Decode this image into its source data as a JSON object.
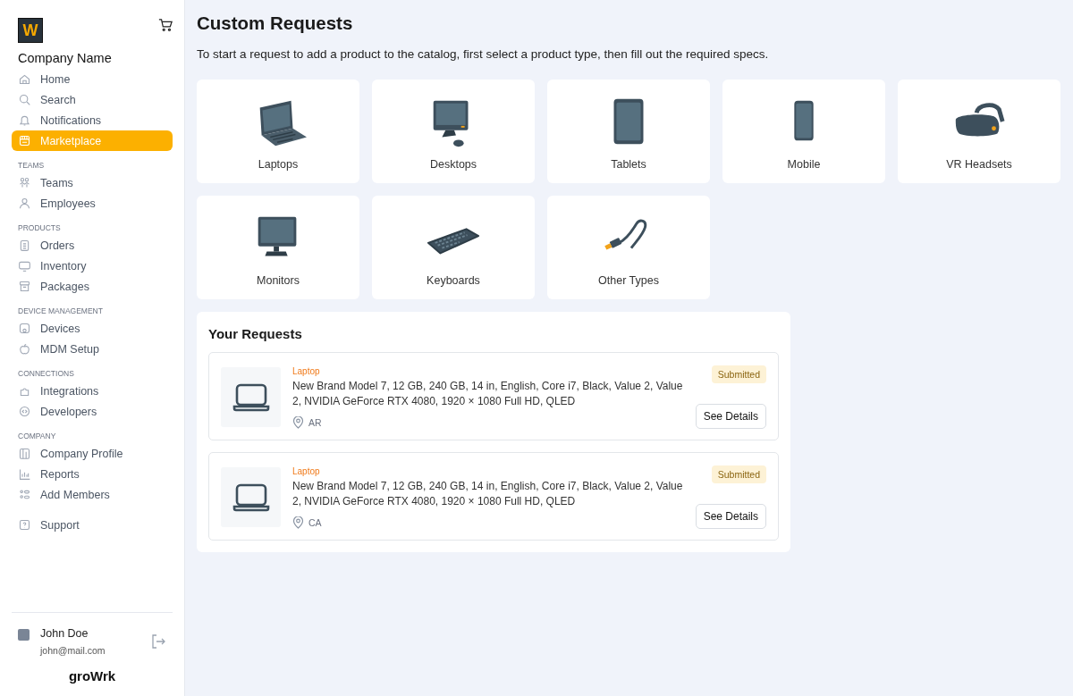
{
  "sidebar": {
    "logo": "W",
    "company": "Company Name",
    "sections": [
      {
        "items": [
          {
            "label": "Home",
            "kind": "home",
            "selected": false
          },
          {
            "label": "Search",
            "kind": "search",
            "selected": false
          },
          {
            "label": "Notifications",
            "kind": "bell",
            "selected": false
          },
          {
            "label": "Marketplace",
            "kind": "store",
            "selected": true
          }
        ]
      },
      {
        "heading": "TEAMS",
        "items": [
          {
            "label": "Teams",
            "kind": "group",
            "selected": false
          },
          {
            "label": "Employees",
            "kind": "person",
            "selected": false
          }
        ]
      },
      {
        "heading": "PRODUCTS",
        "items": [
          {
            "label": "Orders",
            "kind": "document",
            "selected": false
          },
          {
            "label": "Inventory",
            "kind": "monitor",
            "selected": false
          },
          {
            "label": "Packages",
            "kind": "archive",
            "selected": false
          }
        ]
      },
      {
        "heading": "DEVICE MANAGEMENT",
        "items": [
          {
            "label": "Devices",
            "kind": "device",
            "selected": false
          },
          {
            "label": "MDM Setup",
            "kind": "apple",
            "selected": false
          }
        ]
      },
      {
        "heading": "CONNECTIONS",
        "items": [
          {
            "label": "Integrations",
            "kind": "puzzle",
            "selected": false
          },
          {
            "label": "Developers",
            "kind": "code",
            "selected": false
          }
        ]
      },
      {
        "heading": "COMPANY",
        "items": [
          {
            "label": "Company Profile",
            "kind": "building",
            "selected": false
          },
          {
            "label": "Reports",
            "kind": "chart",
            "selected": false
          },
          {
            "label": "Add Members",
            "kind": "members",
            "selected": false
          }
        ]
      },
      {
        "items": [
          {
            "label": "Support",
            "kind": "help",
            "selected": false
          }
        ]
      }
    ],
    "user": {
      "name": "John Doe",
      "email": "john@mail.com"
    },
    "brand": "groWrk"
  },
  "page": {
    "title": "Custom Requests",
    "subtitle": "To start a request to add a product to the catalog, first select a product type, then fill out the required specs."
  },
  "product_types": [
    {
      "label": "Laptops",
      "kind": "laptop"
    },
    {
      "label": "Desktops",
      "kind": "desktop"
    },
    {
      "label": "Tablets",
      "kind": "tablet"
    },
    {
      "label": "Mobile",
      "kind": "mobile"
    },
    {
      "label": "VR Headsets",
      "kind": "vr"
    },
    {
      "label": "Monitors",
      "kind": "monitor"
    },
    {
      "label": "Keyboards",
      "kind": "keyboard"
    },
    {
      "label": "Other Types",
      "kind": "cable"
    }
  ],
  "requests": {
    "title": "Your Requests",
    "items": [
      {
        "category": "Laptop",
        "description": "New Brand Model 7, 12 GB, 240 GB, 14 in, English, Core i7, Black, Value 2, Value 2, NVIDIA GeForce RTX 4080, 1920 × 1080 Full HD, QLED",
        "location": "AR",
        "status": "Submitted",
        "button": "See Details"
      },
      {
        "category": "Laptop",
        "description": "New Brand Model 7, 12 GB, 240 GB, 14 in, English, Core i7, Black, Value 2, Value 2, NVIDIA GeForce RTX 4080, 1920 × 1080 Full HD, QLED",
        "location": "CA",
        "status": "Submitted",
        "button": "See Details"
      }
    ]
  }
}
